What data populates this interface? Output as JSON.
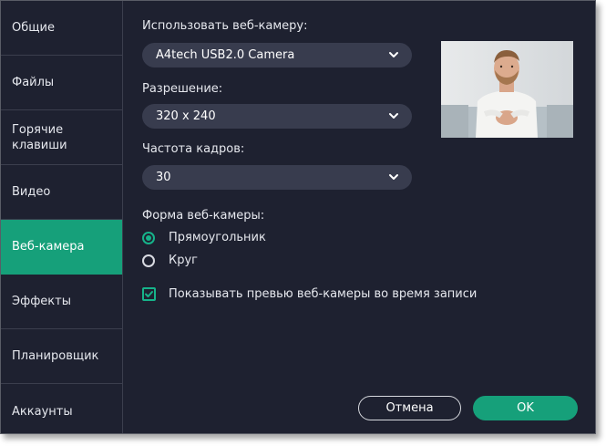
{
  "sidebar": {
    "items": [
      {
        "label": "Общие"
      },
      {
        "label": "Файлы"
      },
      {
        "label": "Горячие клавиши"
      },
      {
        "label": "Видео"
      },
      {
        "label": "Веб-камера"
      },
      {
        "label": "Эффекты"
      },
      {
        "label": "Планировщик"
      },
      {
        "label": "Аккаунты"
      }
    ],
    "active_index": 4
  },
  "webcam": {
    "camera_label": "Использовать веб-камеру:",
    "camera_value": "A4tech USB2.0 Camera",
    "resolution_label": "Разрешение:",
    "resolution_value": "320 x 240",
    "framerate_label": "Частота кадров:",
    "framerate_value": "30",
    "shape_label": "Форма веб-камеры:",
    "shape_options": [
      {
        "label": "Прямоугольник",
        "selected": true
      },
      {
        "label": "Круг",
        "selected": false
      }
    ],
    "preview_checkbox_label": "Показывать превью веб-камеры во время записи",
    "preview_checkbox_checked": true
  },
  "buttons": {
    "cancel": "Отмена",
    "ok": "OK"
  },
  "icons": {
    "select_arrow": "chevron-down-icon",
    "check": "checkmark-icon"
  },
  "colors": {
    "accent": "#16a07a",
    "background": "#1e2130",
    "field": "#383c4e"
  }
}
